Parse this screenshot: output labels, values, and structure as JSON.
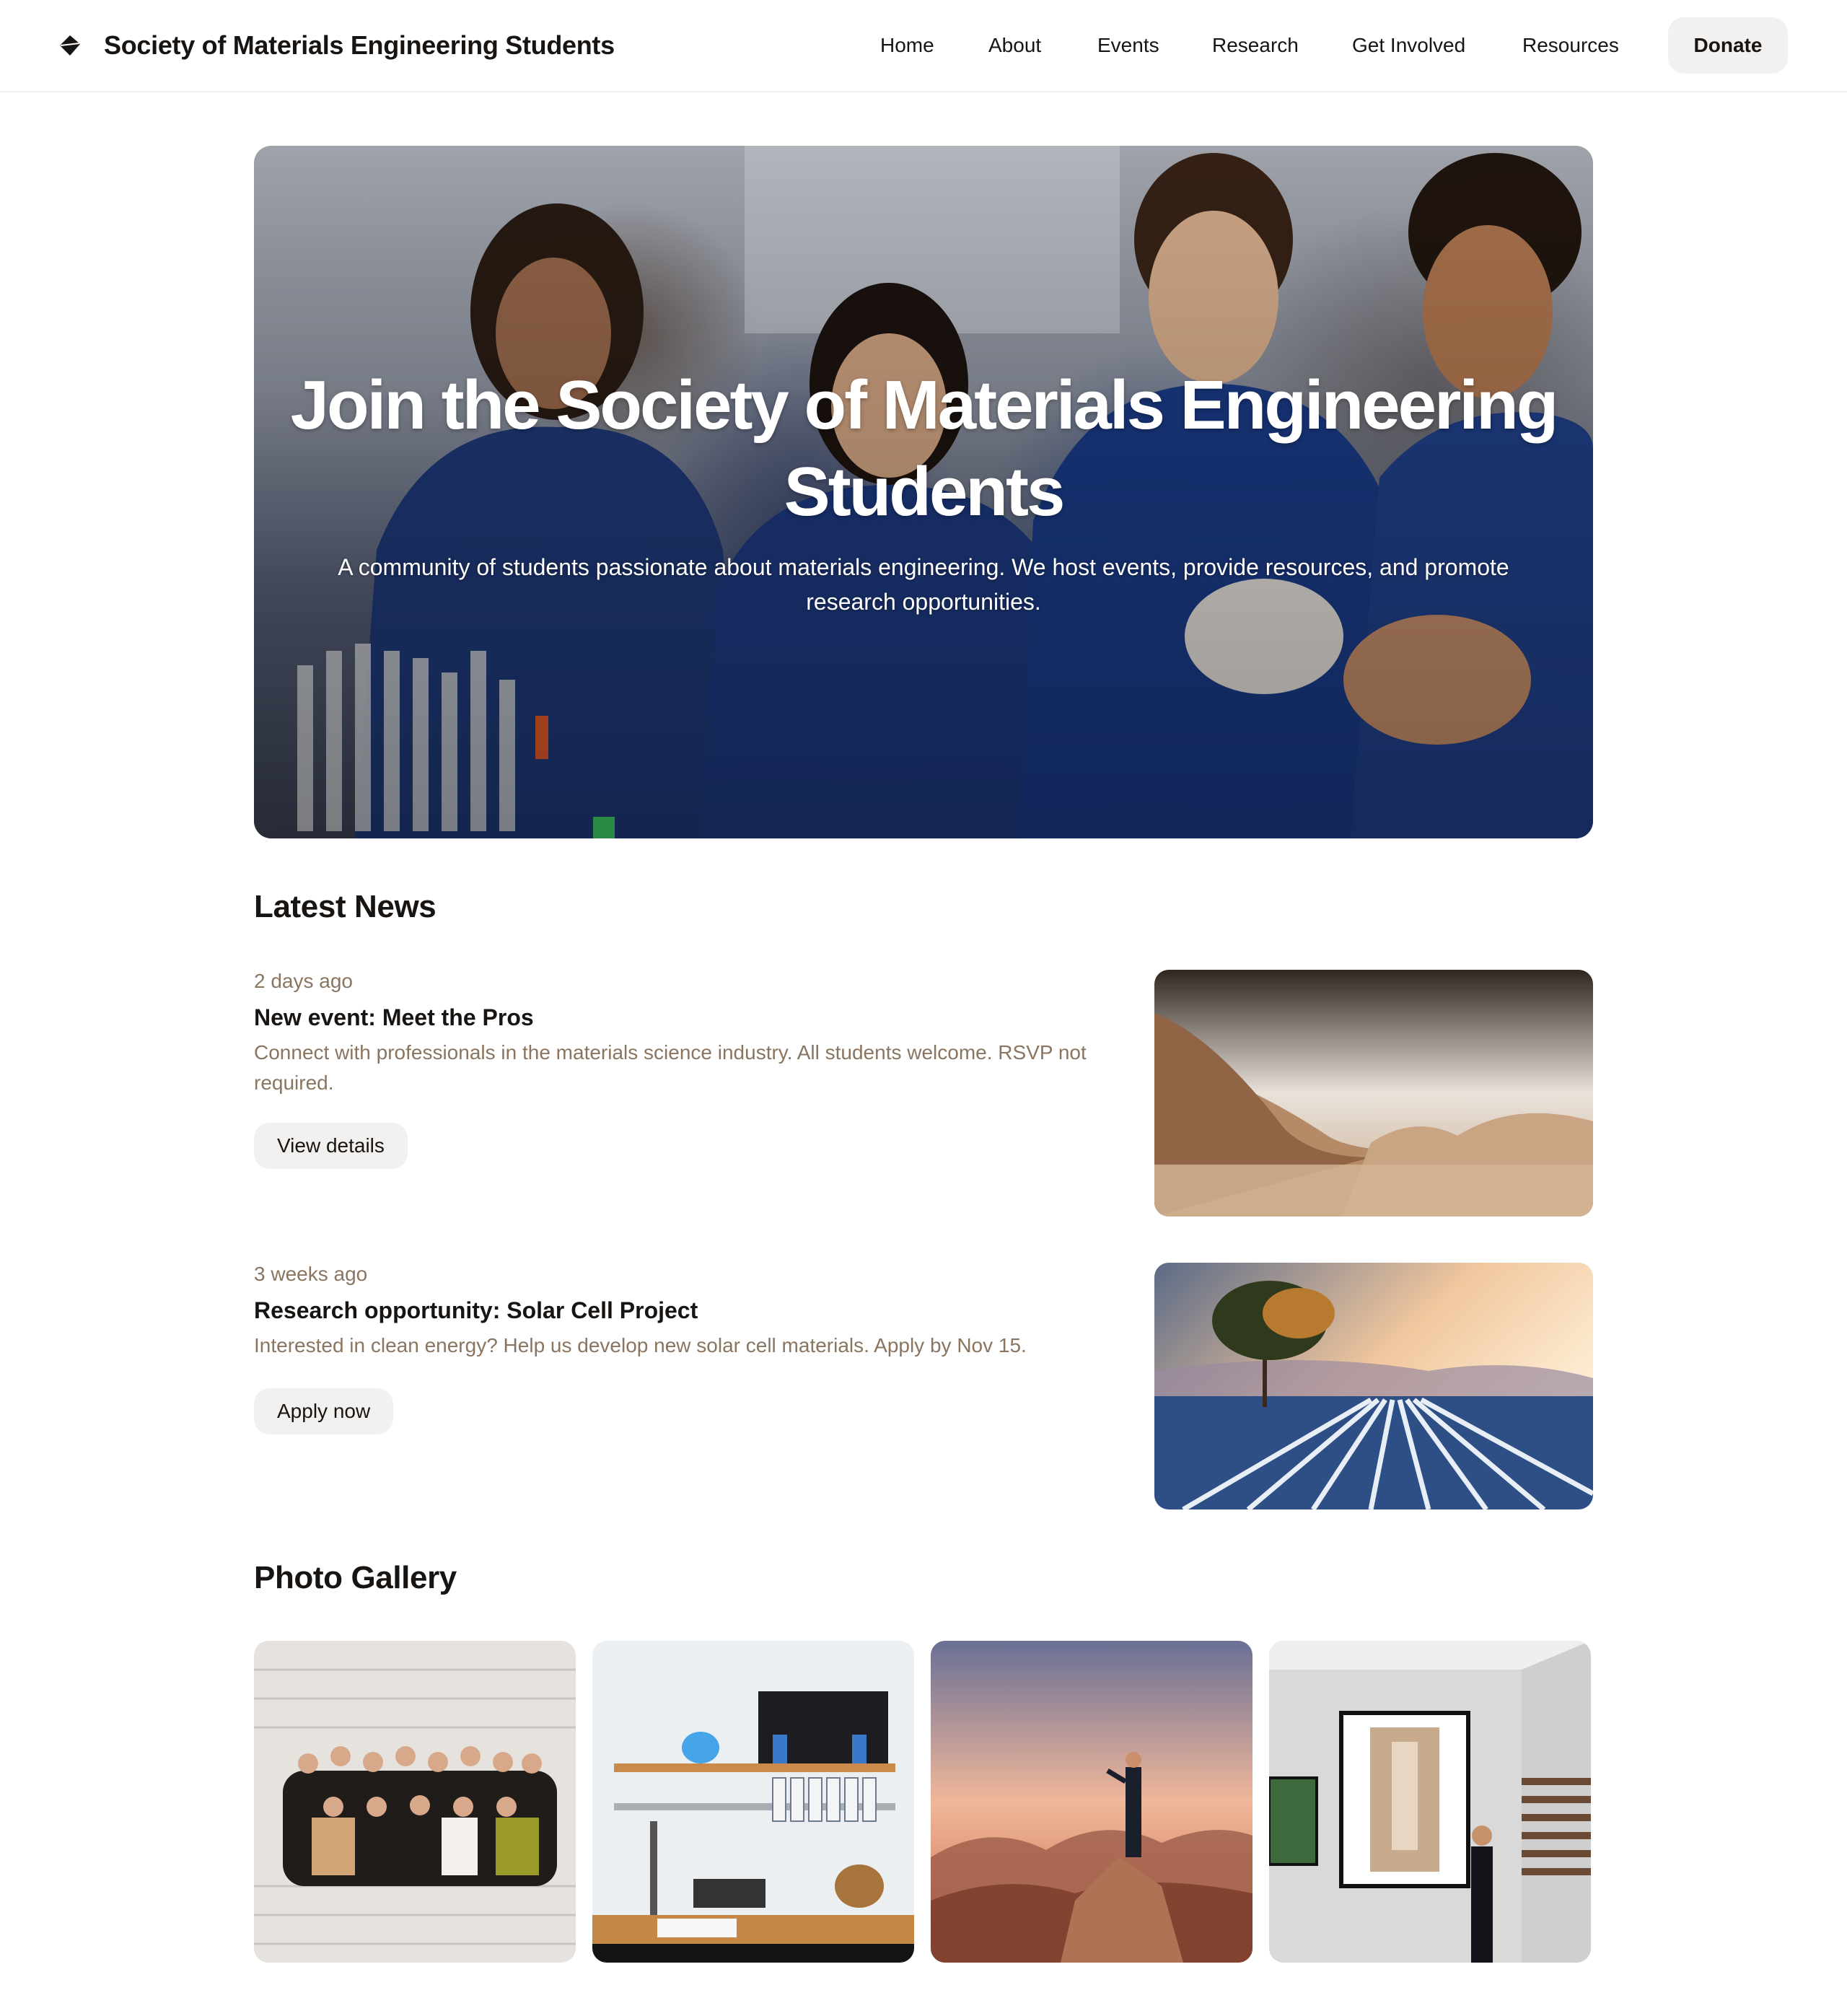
{
  "header": {
    "site_name": "Society of Materials Engineering Students",
    "logo_icon": "diamond-logo-icon",
    "nav": [
      "Home",
      "About",
      "Events",
      "Research",
      "Get Involved",
      "Resources"
    ],
    "donate_label": "Donate"
  },
  "hero": {
    "title": "Join the Society of Materials Engineering Students",
    "subtitle": "A community of students passionate about materials engineering. We host events, provide resources, and promote research opportunities."
  },
  "news": {
    "heading": "Latest News",
    "items": [
      {
        "date": "2 days ago",
        "title": "New event: Meet the Pros",
        "body": "Connect with professionals in the materials science industry. All students welcome. RSVP not required.",
        "button": "View details"
      },
      {
        "date": "3 weeks ago",
        "title": "Research opportunity: Solar Cell Project",
        "body": "Interested in clean energy? Help us develop new solar cell materials. Apply by Nov 15.",
        "button": "Apply now"
      }
    ]
  },
  "gallery": {
    "heading": "Photo Gallery"
  },
  "colors": {
    "text": "#181411",
    "muted": "#8a7560",
    "button_bg": "#f2f1ef"
  }
}
